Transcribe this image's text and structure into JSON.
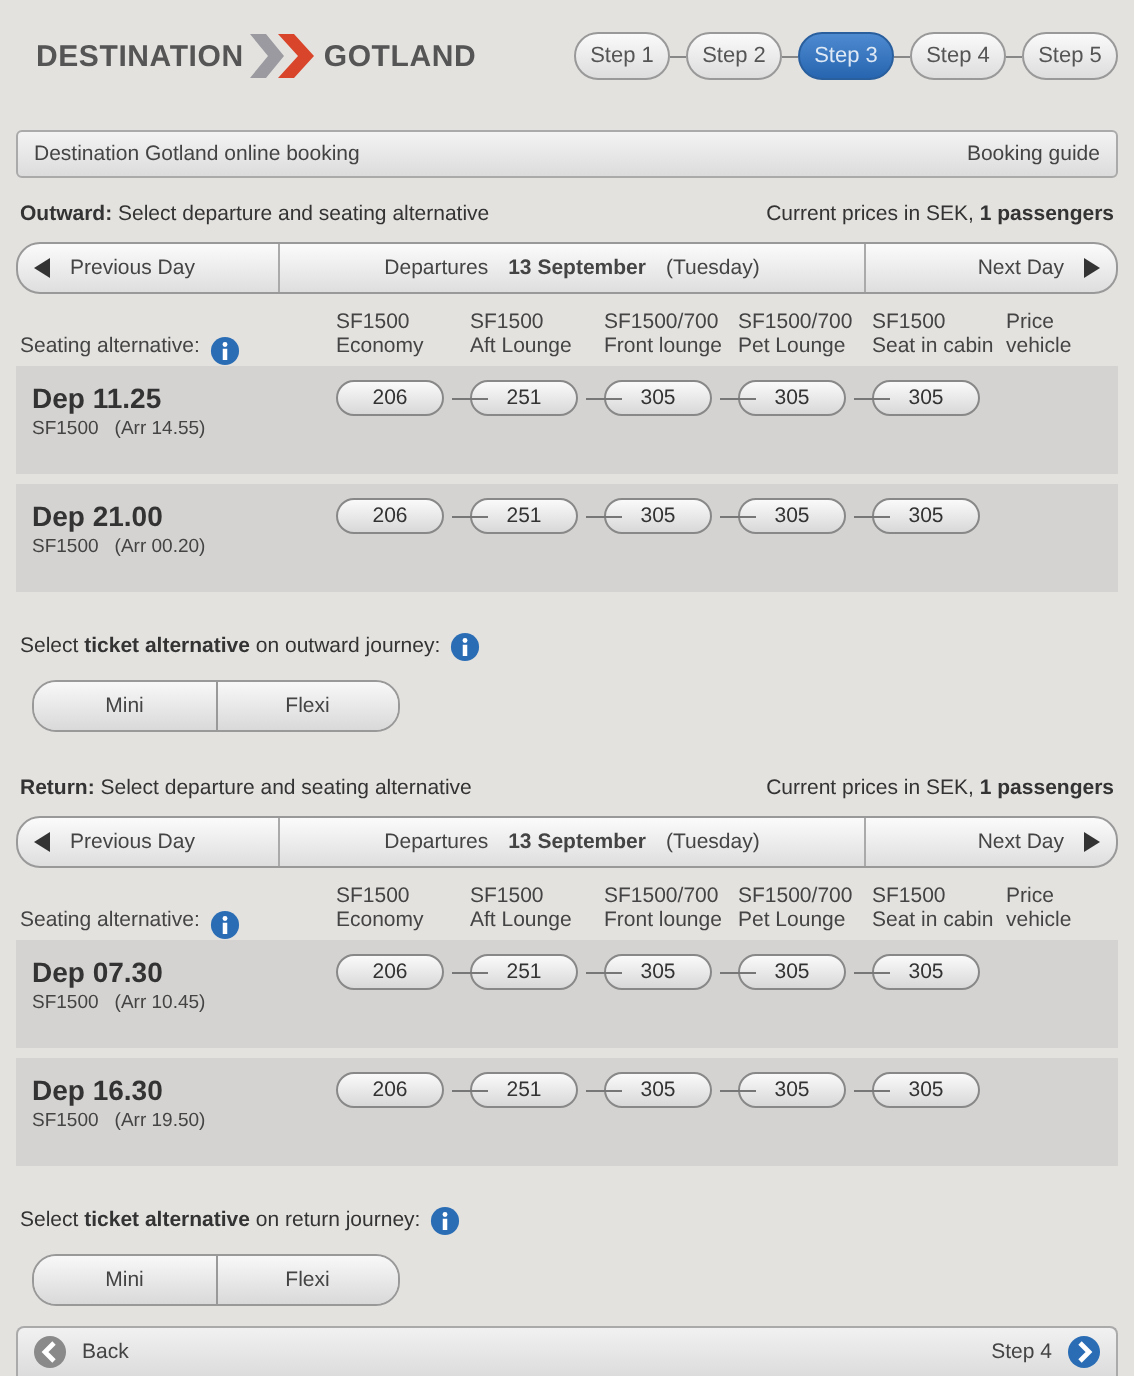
{
  "logo": {
    "left": "DESTINATION",
    "right": "GOTLAND"
  },
  "steps": [
    {
      "label": "Step 1",
      "selected": false
    },
    {
      "label": "Step 2",
      "selected": false
    },
    {
      "label": "Step 3",
      "selected": true
    },
    {
      "label": "Step 4",
      "selected": false
    },
    {
      "label": "Step 5",
      "selected": false
    }
  ],
  "booking_bar": {
    "title": "Destination Gotland online booking",
    "link": "Booking guide"
  },
  "journeys": [
    {
      "heading": "**Outward:** Select departure and seating alternative",
      "prices_note": "Current prices in SEK, **1 passengers**",
      "day_nav": {
        "previous": "Previous Day",
        "date": "Departures **13 September** (Tuesday)",
        "next": "Next Day"
      },
      "seating_label": "Seating alternative:",
      "columns": [
        {
          "line1": "SF1500",
          "line2": "Economy"
        },
        {
          "line1": "SF1500",
          "line2": "Aft Lounge"
        },
        {
          "line1": "SF1500/700",
          "line2": "Front lounge"
        },
        {
          "line1": "SF1500/700",
          "line2": "Pet Lounge"
        },
        {
          "line1": "SF1500",
          "line2": "Seat in cabin"
        },
        {
          "line1": "Price",
          "line2": "vehicle"
        }
      ],
      "departures": [
        {
          "time": "Dep 11.25",
          "vessel": "SF1500",
          "arrival": "(Arr 14.55)",
          "prices": [
            "206",
            "251",
            "305",
            "305",
            "305"
          ]
        },
        {
          "time": "Dep 21.00",
          "vessel": "SF1500",
          "arrival": "(Arr 00.20)",
          "prices": [
            "206",
            "251",
            "305",
            "305",
            "305"
          ]
        }
      ],
      "ticket_label": "Select **ticket alternative** on outward journey:",
      "tickets": [
        {
          "label": "Mini",
          "selected": false
        },
        {
          "label": "Flexi",
          "selected": false
        }
      ]
    },
    {
      "heading": "**Return:** Select departure and seating alternative",
      "prices_note": "Current prices in SEK, **1 passengers**",
      "day_nav": {
        "previous": "Previous Day",
        "date": "Departures **13 September** (Tuesday)",
        "next": "Next Day"
      },
      "seating_label": "Seating alternative:",
      "columns": [
        {
          "line1": "SF1500",
          "line2": "Economy"
        },
        {
          "line1": "SF1500",
          "line2": "Aft Lounge"
        },
        {
          "line1": "SF1500/700",
          "line2": "Front lounge"
        },
        {
          "line1": "SF1500/700",
          "line2": "Pet Lounge"
        },
        {
          "line1": "SF1500",
          "line2": "Seat in cabin"
        },
        {
          "line1": "Price",
          "line2": "vehicle"
        }
      ],
      "departures": [
        {
          "time": "Dep 07.30",
          "vessel": "SF1500",
          "arrival": "(Arr 10.45)",
          "prices": [
            "206",
            "251",
            "305",
            "305",
            "305"
          ]
        },
        {
          "time": "Dep 16.30",
          "vessel": "SF1500",
          "arrival": "(Arr 19.50)",
          "prices": [
            "206",
            "251",
            "305",
            "305",
            "305"
          ]
        }
      ],
      "ticket_label": "Select **ticket alternative** on return journey:",
      "tickets": [
        {
          "label": "Mini",
          "selected": false
        },
        {
          "label": "Flexi",
          "selected": false
        }
      ]
    }
  ],
  "footer": {
    "back": "Back",
    "next": "Step 4"
  }
}
